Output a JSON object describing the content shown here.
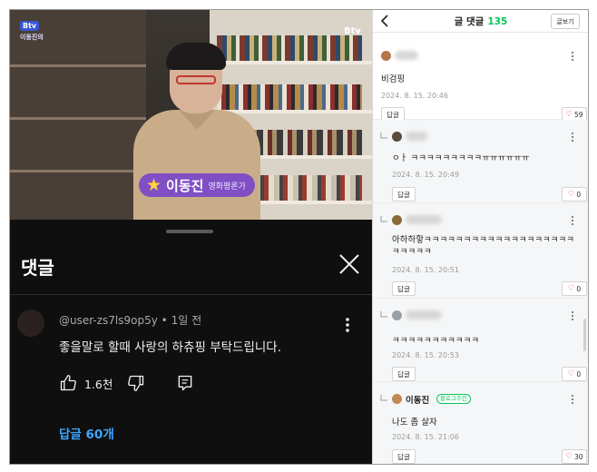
{
  "video": {
    "logo_left": "Btv",
    "logo_left_sub": "이동진의",
    "logo_right": "Btv",
    "caption_name": "이동진",
    "caption_role": "영화평론가"
  },
  "youtube": {
    "title": "댓글",
    "comment": {
      "author": "@user-zs7ls9op5y",
      "time": "1일 전",
      "text": "좋을말로 할때 사랑의 하츄핑 부탁드립니다.",
      "likes": "1.6천"
    },
    "replies_label": "답글 60개",
    "colors": {
      "background": "#0f0f0f",
      "link": "#3ea6ff"
    }
  },
  "blog": {
    "header": {
      "title": "글 댓글",
      "count": "135",
      "view_button": "글보기"
    },
    "reply_label": "답글",
    "comments": [
      {
        "nick": "",
        "text": "비검핑",
        "date": "2024. 8. 15. 20:46",
        "likes": "59",
        "is_reply": false
      },
      {
        "nick": "",
        "text": "ㅇㅏ ㅋㅋㅋㅋㅋㅋㅋㅋㅋㅠㅠㅠㅠㅠㅠ",
        "date": "2024. 8. 15. 20:49",
        "likes": "0",
        "is_reply": true
      },
      {
        "nick": "",
        "text": "아하하핳ㅋㅋㅋㅋㅋㅋㅋㅋㅋㅋㅋㅋㅋㅋㅋㅋㅋㅋㅋㅋㅋㅋㅋㅋ",
        "date": "2024. 8. 15. 20:51",
        "likes": "0",
        "is_reply": true
      },
      {
        "nick": "",
        "text": "ㅋㅋㅋㅋㅋㅋㅋㅋㅋㅋㅋ",
        "date": "2024. 8. 15. 20:53",
        "likes": "0",
        "is_reply": true
      },
      {
        "nick": "이동진",
        "owner_badge": "블로그주인",
        "text": "나도 좀 살자",
        "date": "2024. 8. 15. 21:06",
        "likes": "30",
        "is_reply": true
      }
    ],
    "colors": {
      "accent": "#03c75a",
      "heart": "#e0405a"
    }
  }
}
